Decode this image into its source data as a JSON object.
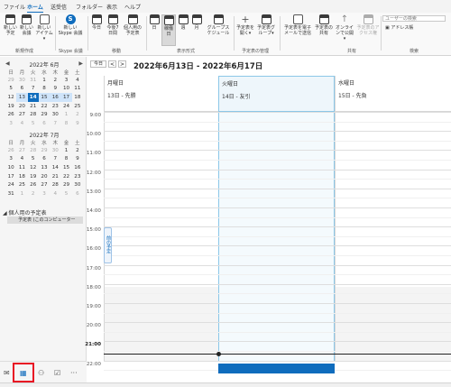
{
  "tabs": [
    "ファイル",
    "ホーム",
    "送受信",
    "フォルダー",
    "表示",
    "ヘルプ"
  ],
  "ribbon": {
    "new_appt": "新しい予定",
    "new_meeting": "新しい会議",
    "new_item": "新しいアイテム▾",
    "skype": "新しいSkype 会議",
    "today": "今日",
    "next7": "今後7日間",
    "personal": "個人用の予定表",
    "day": "日",
    "workweek": "稼働日",
    "week": "週",
    "month": "月",
    "group_schedule": "グループスケジュール",
    "open_cal": "予定表を開く▾",
    "cal_groups": "予定表グループ▾",
    "email_cal": "予定表を電子メールで送信",
    "share_cal": "予定表の共有",
    "publish_online": "オンラインで公開▾",
    "cal_perm": "予定表のアクセス権",
    "user_search": "ユーザーの検索",
    "address_book": "アドレス帳",
    "group_new": "新規作成",
    "group_skype": "Skype 会議",
    "group_move": "移動",
    "group_arrange": "表示形式",
    "group_manage": "予定表の管理",
    "group_share": "共有",
    "group_find": "検索"
  },
  "minical1": {
    "title": "2022年 6月",
    "dow": [
      "日",
      "月",
      "火",
      "水",
      "木",
      "金",
      "土"
    ],
    "weeks": [
      [
        "29",
        "30",
        "31",
        "1",
        "2",
        "3",
        "4"
      ],
      [
        "5",
        "6",
        "7",
        "8",
        "9",
        "10",
        "11"
      ],
      [
        "12",
        "13",
        "14",
        "15",
        "16",
        "17",
        "18"
      ],
      [
        "19",
        "20",
        "21",
        "22",
        "23",
        "24",
        "25"
      ],
      [
        "26",
        "27",
        "28",
        "29",
        "30",
        "1",
        "2"
      ],
      [
        "3",
        "4",
        "5",
        "6",
        "7",
        "8",
        "9"
      ]
    ]
  },
  "minical2": {
    "title": "2022年 7月",
    "dow": [
      "日",
      "月",
      "火",
      "水",
      "木",
      "金",
      "土"
    ],
    "weeks": [
      [
        "26",
        "27",
        "28",
        "29",
        "30",
        "1",
        "2"
      ],
      [
        "3",
        "4",
        "5",
        "6",
        "7",
        "8",
        "9"
      ],
      [
        "10",
        "11",
        "12",
        "13",
        "14",
        "15",
        "16"
      ],
      [
        "17",
        "18",
        "19",
        "20",
        "21",
        "22",
        "23"
      ],
      [
        "24",
        "25",
        "26",
        "27",
        "28",
        "29",
        "30"
      ],
      [
        "31",
        "1",
        "2",
        "3",
        "4",
        "5",
        "6"
      ]
    ]
  },
  "leftpane": {
    "group_label": "個人用の予定表",
    "calendar_item": "予定表 (このコンピューター"
  },
  "header": {
    "today_btn": "今日",
    "prev": "<",
    "next": ">",
    "range": "2022年6月13日 - 2022年6月17日"
  },
  "days": [
    {
      "name": "月曜日",
      "date": "13日 - 先勝"
    },
    {
      "name": "火曜日",
      "date": "14日 - 友引"
    },
    {
      "name": "水曜日",
      "date": "15日 - 先負"
    }
  ],
  "times": [
    "9:00",
    "10:00",
    "11:00",
    "12:00",
    "13:00",
    "14:00",
    "15:00",
    "16:00",
    "17:00",
    "18:00",
    "19:00",
    "20:00",
    "21:00",
    "22:00"
  ],
  "prev_appt": "前の予定",
  "colors": {
    "accent": "#0f6cbd",
    "highlight": "#e81123"
  }
}
